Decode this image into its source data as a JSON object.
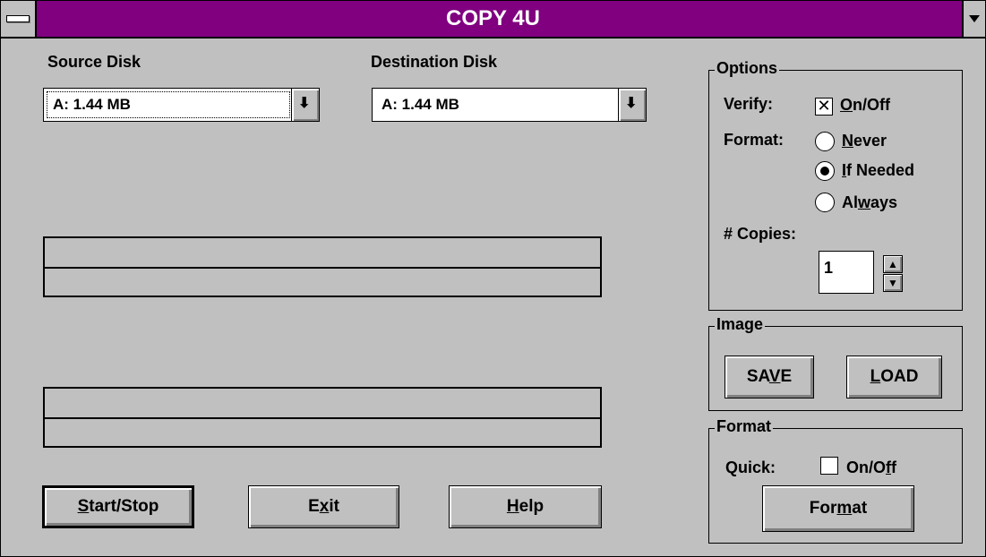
{
  "window": {
    "title": "COPY 4U"
  },
  "source": {
    "label": "Source Disk",
    "value": "A: 1.44 MB"
  },
  "destination": {
    "label": "Destination Disk",
    "value": "A: 1.44 MB"
  },
  "progress": {
    "bar1_fill": 0,
    "bar2_fill": 0
  },
  "buttons": {
    "start_stop": {
      "mn": "S",
      "rest": "tart/Stop"
    },
    "exit": {
      "pre": "E",
      "mn": "x",
      "rest": "it"
    },
    "help": {
      "mn": "H",
      "rest": "elp"
    }
  },
  "options": {
    "title": "Options",
    "verify_label": "Verify:",
    "verify_option": {
      "mn": "O",
      "rest": "n/Off"
    },
    "verify_checked": true,
    "format_label": "Format:",
    "format_options": [
      {
        "pre": "",
        "mn": "N",
        "rest": "ever",
        "selected": false
      },
      {
        "pre": "",
        "mn": "I",
        "rest": "f Needed",
        "selected": true
      },
      {
        "pre": "Al",
        "mn": "w",
        "rest": "ays",
        "selected": false
      }
    ],
    "copies_label": "# Copies:",
    "copies_value": "1"
  },
  "image": {
    "title": "Image",
    "save": {
      "pre": "SA",
      "mn": "V",
      "rest": "E"
    },
    "load": {
      "pre": "",
      "mn": "L",
      "rest": "OAD"
    }
  },
  "format_group": {
    "title": "Format",
    "quick_label": "Quick:",
    "quick_option": {
      "pre": "On/O",
      "mn": "f",
      "rest": "f"
    },
    "quick_checked": false,
    "button": {
      "pre": "For",
      "mn": "m",
      "rest": "at"
    }
  },
  "icons": {
    "combo_arrow": "⬇",
    "spin_up": "▲",
    "spin_down": "▼",
    "check_mark": "✕"
  },
  "colors": {
    "titlebar": "#800080",
    "face": "#c0c0c0"
  }
}
